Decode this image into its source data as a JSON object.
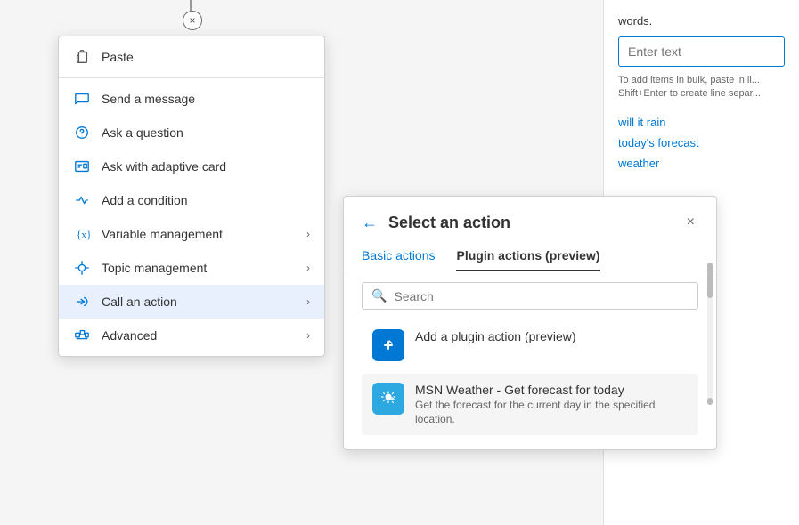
{
  "background": {
    "words_label": "words.",
    "enter_text_placeholder": "Enter text",
    "hint_text": "To add items in bulk, paste in li... Shift+Enter to create line separ...",
    "tags": [
      "will it rain",
      "today's forecast",
      "weather"
    ]
  },
  "close_circle": "×",
  "context_menu": {
    "items": [
      {
        "id": "paste",
        "label": "Paste",
        "icon": "paste-icon",
        "has_arrow": false
      },
      {
        "id": "send-message",
        "label": "Send a message",
        "icon": "message-icon",
        "has_arrow": false
      },
      {
        "id": "ask-question",
        "label": "Ask a question",
        "icon": "question-icon",
        "has_arrow": false
      },
      {
        "id": "ask-adaptive-card",
        "label": "Ask with adaptive card",
        "icon": "card-icon",
        "has_arrow": false
      },
      {
        "id": "add-condition",
        "label": "Add a condition",
        "icon": "condition-icon",
        "has_arrow": false
      },
      {
        "id": "variable-management",
        "label": "Variable management",
        "icon": "variable-icon",
        "has_arrow": true
      },
      {
        "id": "topic-management",
        "label": "Topic management",
        "icon": "topic-icon",
        "has_arrow": true
      },
      {
        "id": "call-action",
        "label": "Call an action",
        "icon": "action-icon",
        "has_arrow": true,
        "active": true
      },
      {
        "id": "advanced",
        "label": "Advanced",
        "icon": "advanced-icon",
        "has_arrow": true
      }
    ]
  },
  "select_action": {
    "title": "Select an action",
    "back_label": "←",
    "close_label": "×",
    "tabs": [
      {
        "id": "basic",
        "label": "Basic actions",
        "active": false
      },
      {
        "id": "plugin",
        "label": "Plugin actions (preview)",
        "active": true
      }
    ],
    "search": {
      "placeholder": "Search",
      "icon": "search-icon"
    },
    "actions": [
      {
        "id": "add-plugin",
        "icon_type": "blue",
        "icon": "plugin-add-icon",
        "title": "Add a plugin action (preview)",
        "description": ""
      },
      {
        "id": "msn-weather",
        "icon_type": "light-blue",
        "icon": "weather-icon",
        "title": "MSN Weather - Get forecast for today",
        "description": "Get the forecast for the current day in the specified location."
      }
    ]
  }
}
